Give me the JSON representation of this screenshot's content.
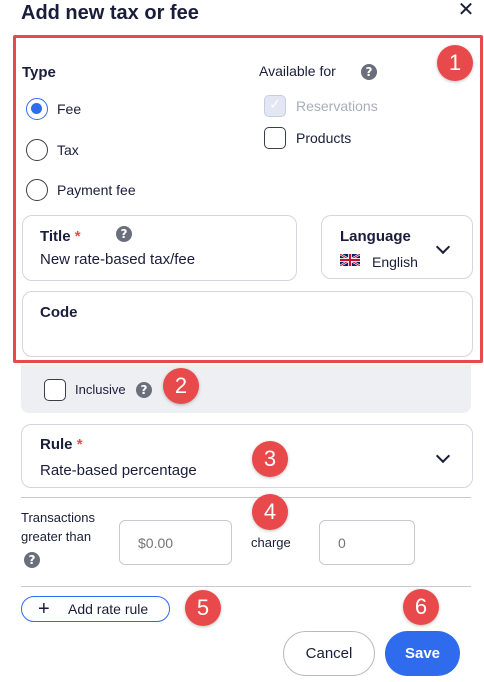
{
  "dialog": {
    "title": "Add new tax or fee",
    "close_symbol": "✕"
  },
  "type_section": {
    "label": "Type",
    "options": [
      {
        "label": "Fee",
        "selected": true
      },
      {
        "label": "Tax",
        "selected": false
      },
      {
        "label": "Payment fee",
        "selected": false
      }
    ]
  },
  "available_section": {
    "label": "Available for",
    "help_icon": "help-icon",
    "options": [
      {
        "label": "Reservations",
        "checked": true,
        "disabled": true
      },
      {
        "label": "Products",
        "checked": false,
        "disabled": false
      }
    ]
  },
  "title_field": {
    "label": "Title",
    "required_mark": "*",
    "value": "New rate-based tax/fee",
    "help_symbol": "?"
  },
  "language_field": {
    "label": "Language",
    "value": "English",
    "flag_icon": "uk-flag-icon"
  },
  "code_field": {
    "label": "Code",
    "value": ""
  },
  "inclusive": {
    "label": "Inclusive",
    "checked": false,
    "help_symbol": "?"
  },
  "rule_field": {
    "label": "Rule",
    "required_mark": "*",
    "value": "Rate-based percentage"
  },
  "transaction_rule": {
    "label_line1": "Transactions",
    "label_line2": "greater than",
    "help_symbol": "?",
    "threshold_placeholder": "$0.00",
    "charge_label": "charge",
    "charge_placeholder": "0"
  },
  "actions": {
    "add_rate_rule_label": "Add rate rule",
    "add_symbol": "+",
    "cancel_label": "Cancel",
    "save_label": "Save"
  },
  "callouts": [
    "1",
    "2",
    "3",
    "4",
    "5",
    "6"
  ],
  "colors": {
    "accent": "#2f6bed",
    "callout": "#e8494a",
    "text": "#1a1d3a",
    "panel": "#eeeff2"
  }
}
